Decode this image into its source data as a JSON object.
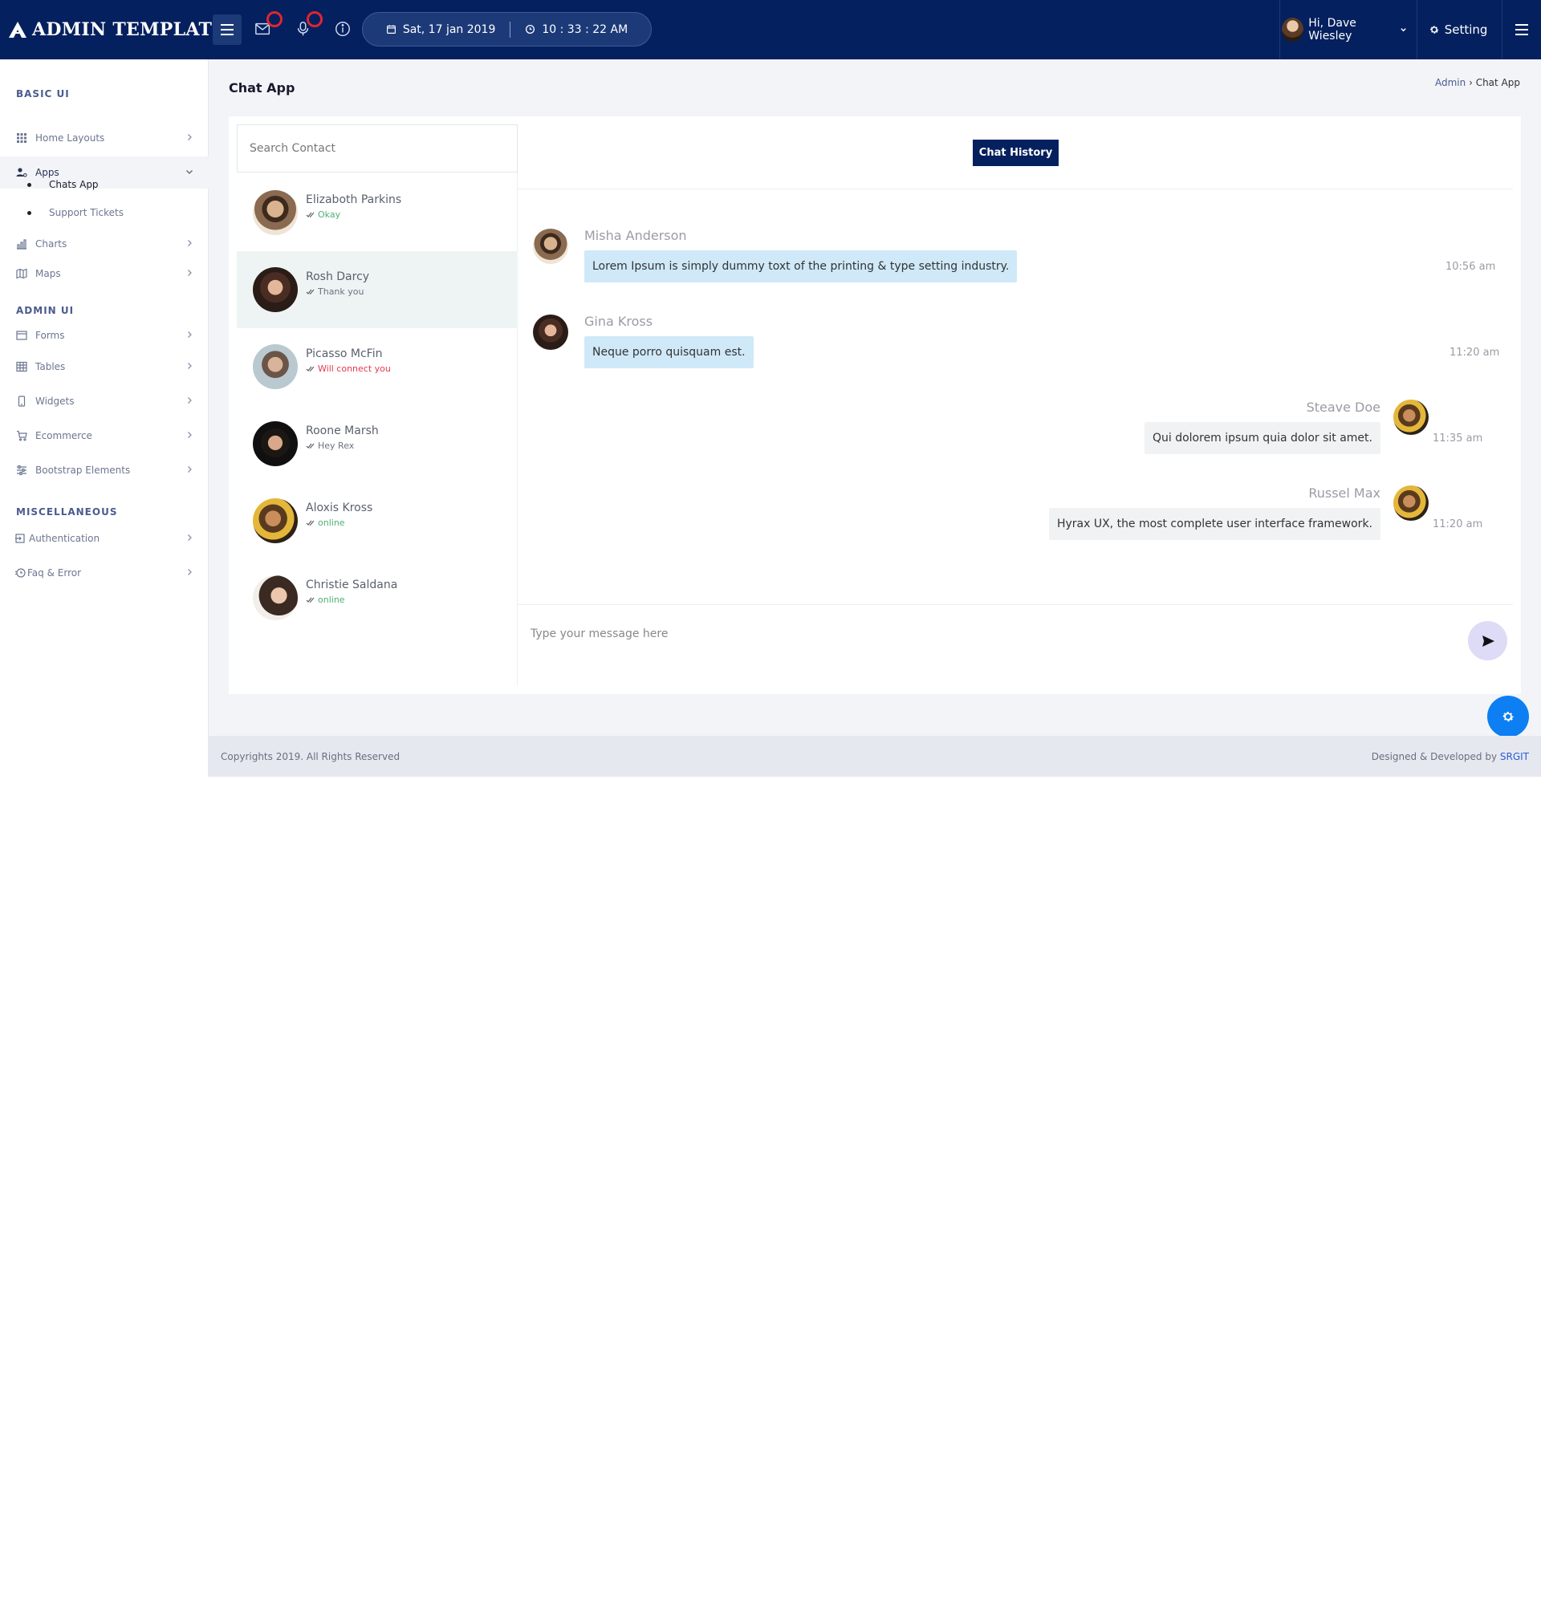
{
  "app": {
    "brand": "ADMIN TEMPLATE"
  },
  "header": {
    "date": "Sat, 17 jan 2019",
    "time": "10 : 33 : 22 AM",
    "user_greeting": "Hi, Dave Wiesley",
    "settings_label": "Setting",
    "icons": [
      "menu-icon",
      "mail-icon",
      "mic-icon",
      "info-icon",
      "calendar-icon",
      "clock-icon",
      "gear-icon"
    ]
  },
  "sidebar": {
    "basic_title": "BASIC UI",
    "admin_title": "ADMIN UI",
    "misc_title": "MISCELLANEOUS",
    "items": [
      {
        "label": "Home Layouts",
        "icon": "grid-icon"
      },
      {
        "label": "Apps",
        "icon": "user-gear-icon"
      },
      {
        "label": "Charts",
        "icon": "bar-chart-icon"
      },
      {
        "label": "Maps",
        "icon": "map-icon"
      },
      {
        "label": "Forms",
        "icon": "form-icon"
      },
      {
        "label": "Tables",
        "icon": "table-icon"
      },
      {
        "label": "Widgets",
        "icon": "mobile-icon"
      },
      {
        "label": "Ecommerce",
        "icon": "cart-icon"
      },
      {
        "label": "Bootstrap Elements",
        "icon": "sliders-icon"
      },
      {
        "label": "Authentication",
        "icon": "login-icon"
      },
      {
        "label": "Faq & Error",
        "icon": "history-icon"
      }
    ],
    "sub_items": [
      "Chats App",
      "Support Tickets"
    ]
  },
  "page": {
    "title": "Chat App",
    "breadcrumb_root": "Admin",
    "breadcrumb_sep": " › ",
    "breadcrumb_current": "Chat App"
  },
  "contacts": {
    "search_placeholder": "Search Contact",
    "list": [
      {
        "name": "Elizaboth Parkins",
        "status": "Okay"
      },
      {
        "name": "Rosh Darcy",
        "status": "Thank you"
      },
      {
        "name": "Picasso McFin",
        "status": "Will connect you"
      },
      {
        "name": "Roone Marsh",
        "status": "Hey Rex"
      },
      {
        "name": "Aloxis Kross",
        "status": "online"
      },
      {
        "name": "Christie Saldana",
        "status": "online"
      }
    ]
  },
  "chat": {
    "history_label": "Chat History",
    "messages": [
      {
        "name": "Misha Anderson",
        "text": "Lorem Ipsum is simply dummy toxt of the printing & type setting industry.",
        "time": "10:56 am"
      },
      {
        "name": "Gina Kross",
        "text": "Neque porro quisquam est.",
        "time": "11:20 am"
      },
      {
        "name": "Steave Doe",
        "text": "Qui dolorem ipsum quia dolor sit amet.",
        "time": "11:35 am"
      },
      {
        "name": "Russel Max",
        "text": "Hyrax UX, the most complete user interface framework.",
        "time": "11:20 am"
      }
    ],
    "composer_placeholder": "Type your message here"
  },
  "footer": {
    "copyright": "Copyrights 2019. All Rights Reserved",
    "designed": "Designed & Developed by ",
    "company": "SRGIT"
  }
}
